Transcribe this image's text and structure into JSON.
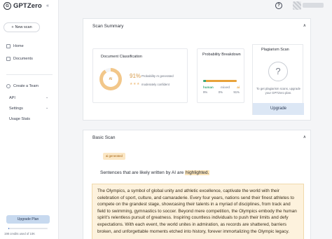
{
  "app": {
    "logo_letter": "G",
    "name": "GPTZero",
    "collapse_glyph": "«"
  },
  "sidebar": {
    "new_scan_label": "New scan",
    "items": [
      {
        "label": "Home"
      },
      {
        "label": "Documents"
      },
      {
        "label": "Create a Team"
      },
      {
        "label": "API"
      },
      {
        "label": "Settings"
      },
      {
        "label": "Usage Stats"
      }
    ],
    "upgrade_plan_label": "Upgrade Plan",
    "credits_text": "198 credits used of 10K",
    "credits_used_fraction": 0.0198
  },
  "header": {
    "help_glyph": "?"
  },
  "scan_summary": {
    "title": "Scan Summary",
    "doc_class": {
      "title": "Document Classification",
      "ring_label": "AI",
      "ring_fraction": 0.91,
      "percent": "91%",
      "percent_label": "Probability AI generated",
      "stars": "★★★",
      "confidence_label": "moderately confident"
    },
    "prob_breakdown": {
      "title": "Probability Breakdown",
      "labels": [
        "human",
        "mixed",
        "ai"
      ],
      "values": [
        "9%",
        "0%",
        "91%"
      ],
      "fractions": [
        0.09,
        0.0,
        0.91
      ],
      "colors": {
        "human": "#3aa87a",
        "mixed": "#9aa3b2",
        "ai": "#e8a23a"
      }
    },
    "plagiarism": {
      "title": "Plagiarism Scan",
      "icon_glyph": "?",
      "text": "To get plagiarism scans, upgrade your GPTZero plan.",
      "button": "Upgrade"
    }
  },
  "basic_scan": {
    "title": "Basic Scan",
    "chip": "ai generated",
    "legend_prefix": "Sentences that are likely written by AI are",
    "legend_highlight": "highlighted.",
    "text": "The Olympics, a symbol of global unity and athletic excellence, captivate the world with their celebration of sport, culture, and camaraderie. Every four years, nations send their finest athletes to compete on the grandest stage, showcasing their talents in a myriad of disciplines, from track and field to swimming, gymnastics to soccer. Beyond mere competition, the Olympics embody the human spirit's relentless pursuit of greatness. Inspiring countless individuals to push their limits and defy expectations. With each event, the world unites in admiration, as records are shattered, barriers broken, and unforgettable moments etched into history, forever immortalizing the Olympic legacy."
  },
  "glyphs": {
    "chevron_up": "∧",
    "chevron_down": "⌄",
    "plus": "+"
  }
}
